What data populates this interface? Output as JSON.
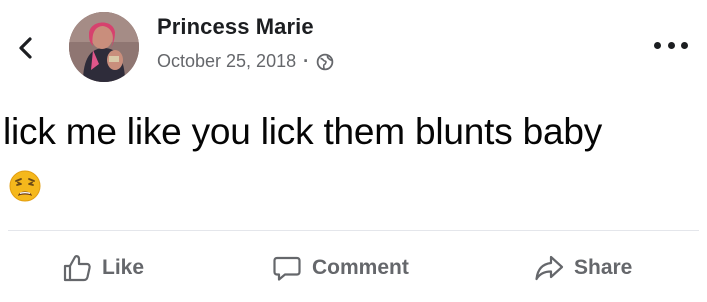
{
  "post": {
    "author": "Princess Marie",
    "date": "October 25, 2018",
    "separator": "·",
    "privacy_icon": "globe-icon",
    "text": "lick me like you lick them blunts baby",
    "emoji": "weary-face"
  },
  "actions": {
    "like": "Like",
    "comment": "Comment",
    "share": "Share"
  },
  "colors": {
    "text_primary": "#1c1e21",
    "text_secondary": "#65676b",
    "divider": "#e4e6eb",
    "emoji_face": "#f5b81c"
  }
}
